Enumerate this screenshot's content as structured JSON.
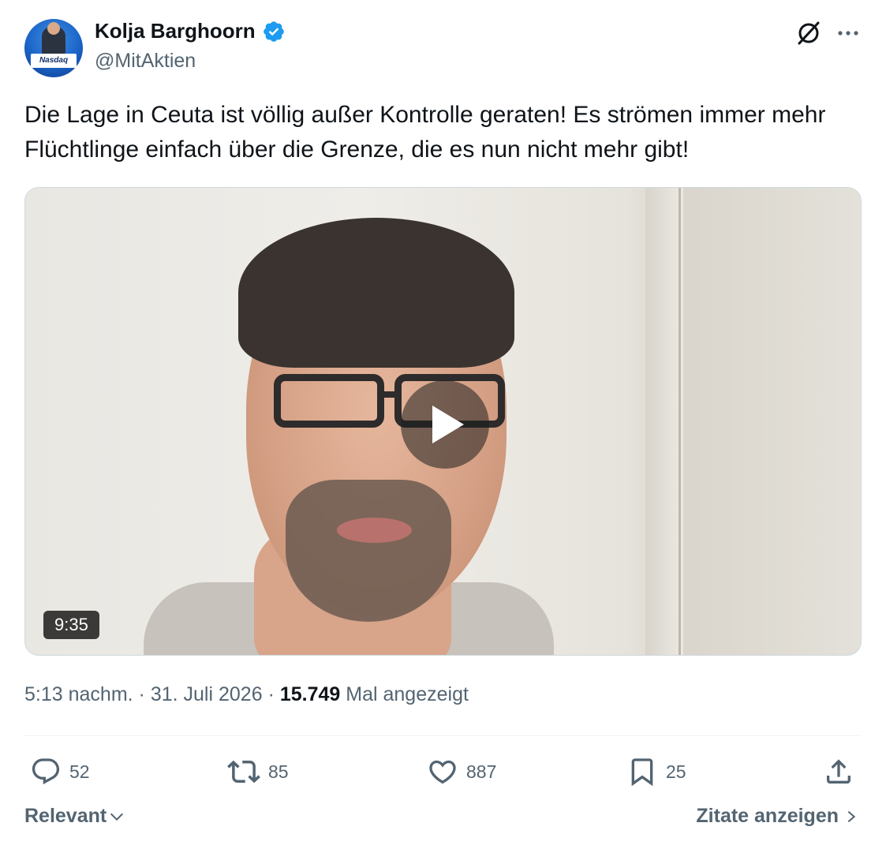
{
  "author": {
    "name": "Kolja Barghoorn",
    "handle": "@MitAktien",
    "avatar_logo_text": "Nasdaq",
    "verified": true
  },
  "header_icons": [
    "grok-icon",
    "more-icon"
  ],
  "tweet": {
    "text": "Die Lage in Ceuta ist völlig außer Kontrolle geraten! Es strömen immer mehr Flüchtlinge einfach über die Grenze, die es nun nicht mehr gibt!"
  },
  "media": {
    "type": "video",
    "duration": "9:35"
  },
  "meta": {
    "time": "5:13 nachm.",
    "separator": "·",
    "date": "31. Juli 2026",
    "views": "15.749",
    "views_label": "Mal angezeigt"
  },
  "actions": {
    "replies": "52",
    "retweets": "85",
    "likes": "887",
    "bookmarks": "25"
  },
  "footer": {
    "sort_label": "Relevant",
    "quotes_label": "Zitate anzeigen"
  },
  "colors": {
    "text": "#0f1419",
    "secondary": "#536471",
    "verified": "#1d9bf0",
    "divider": "#eff3f4"
  }
}
